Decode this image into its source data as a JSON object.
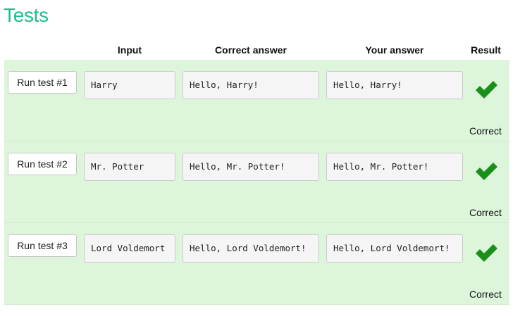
{
  "heading": "Tests",
  "columns": {
    "input": "Input",
    "correct": "Correct answer",
    "yours": "Your answer",
    "result": "Result"
  },
  "colors": {
    "heading": "#1fbf8f",
    "row_background": "#dcf5db",
    "check": "#1a8f1a"
  },
  "tests": [
    {
      "button": "Run test #1",
      "input": "Harry",
      "correct": "Hello, Harry!",
      "yours": "Hello, Harry!",
      "result_icon": "check-icon",
      "result": "Correct"
    },
    {
      "button": "Run test #2",
      "input": "Mr. Potter",
      "correct": "Hello, Mr. Potter!",
      "yours": "Hello, Mr. Potter!",
      "result_icon": "check-icon",
      "result": "Correct"
    },
    {
      "button": "Run test #3",
      "input": "Lord Voldemort",
      "correct": "Hello, Lord Voldemort!",
      "yours": "Hello, Lord Voldemort!",
      "result_icon": "check-icon",
      "result": "Correct"
    }
  ]
}
